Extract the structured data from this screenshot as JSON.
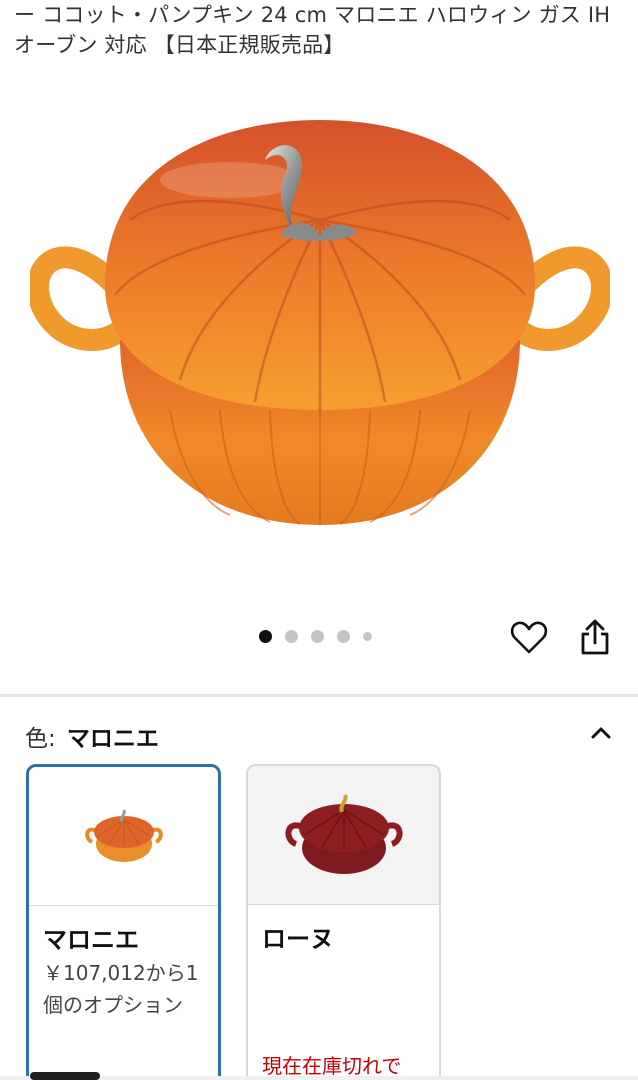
{
  "product": {
    "title": "ー ココット・パンプキン 24 cm マロニエ ハロウィン ガス IH オーブン 対応 【日本正規販売品】"
  },
  "gallery": {
    "image_icon": "pumpkin-cocotte-image",
    "dot_count": 5,
    "active_dot": 1
  },
  "actions": {
    "wishlist_icon": "heart-icon",
    "share_icon": "share-icon"
  },
  "variation": {
    "label": "色:",
    "selected_value": "マロニエ",
    "collapse_icon": "chevron-up-icon",
    "options": [
      {
        "name": "マロニエ",
        "price_text": "￥107,012から1個のオプション",
        "stock_text": "",
        "color": "#e8892a",
        "selected": true
      },
      {
        "name": "ローヌ",
        "price_text": "",
        "stock_text": "現在在庫切れで",
        "color": "#8e1d22",
        "selected": false
      }
    ]
  },
  "colors": {
    "accent": "#2e6fad",
    "out_of_stock": "#c40000",
    "pumpkin_orange": "#e8892a",
    "rhone_red": "#8e1d22"
  }
}
